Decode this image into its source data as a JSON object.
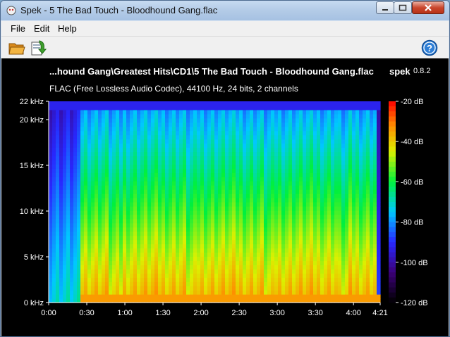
{
  "window": {
    "title": "Spek - 5 The Bad Touch - Bloodhound Gang.flac"
  },
  "menu": {
    "file": "File",
    "edit": "Edit",
    "help": "Help"
  },
  "toolbar": {
    "open_icon": "folder-open-icon",
    "save_icon": "save-icon",
    "help_icon": "help-icon"
  },
  "header": {
    "file_title": "...hound Gang\\Greatest Hits\\CD1\\5 The Bad Touch - Bloodhound Gang.flac",
    "app_name": "spek",
    "app_version": "0.8.2",
    "file_info": "FLAC (Free Lossless Audio Codec), 44100 Hz, 24 bits, 2 channels"
  },
  "chart_data": {
    "type": "heatmap",
    "x_ticks": [
      "0:00",
      "0:30",
      "1:00",
      "1:30",
      "2:00",
      "2:30",
      "3:00",
      "3:30",
      "4:00",
      "4:21"
    ],
    "x_tick_seconds": [
      0,
      30,
      60,
      90,
      120,
      150,
      180,
      210,
      240,
      261
    ],
    "xlim_seconds": [
      0,
      261
    ],
    "y_ticks": [
      "0 kHz",
      "5 kHz",
      "10 kHz",
      "15 kHz",
      "20 kHz",
      "22 kHz"
    ],
    "y_tick_khz": [
      0,
      5,
      10,
      15,
      20,
      22
    ],
    "ylim_khz": [
      0,
      22
    ],
    "colorbar_ticks": [
      "-20 dB",
      "-40 dB",
      "-60 dB",
      "-80 dB",
      "-100 dB",
      "-120 dB"
    ],
    "colorbar_db": [
      -20,
      -40,
      -60,
      -80,
      -100,
      -120
    ],
    "colorbar_range_db": [
      -120,
      -20
    ],
    "colors": {
      "bg": "#000000",
      "text": "#ffffff"
    }
  }
}
